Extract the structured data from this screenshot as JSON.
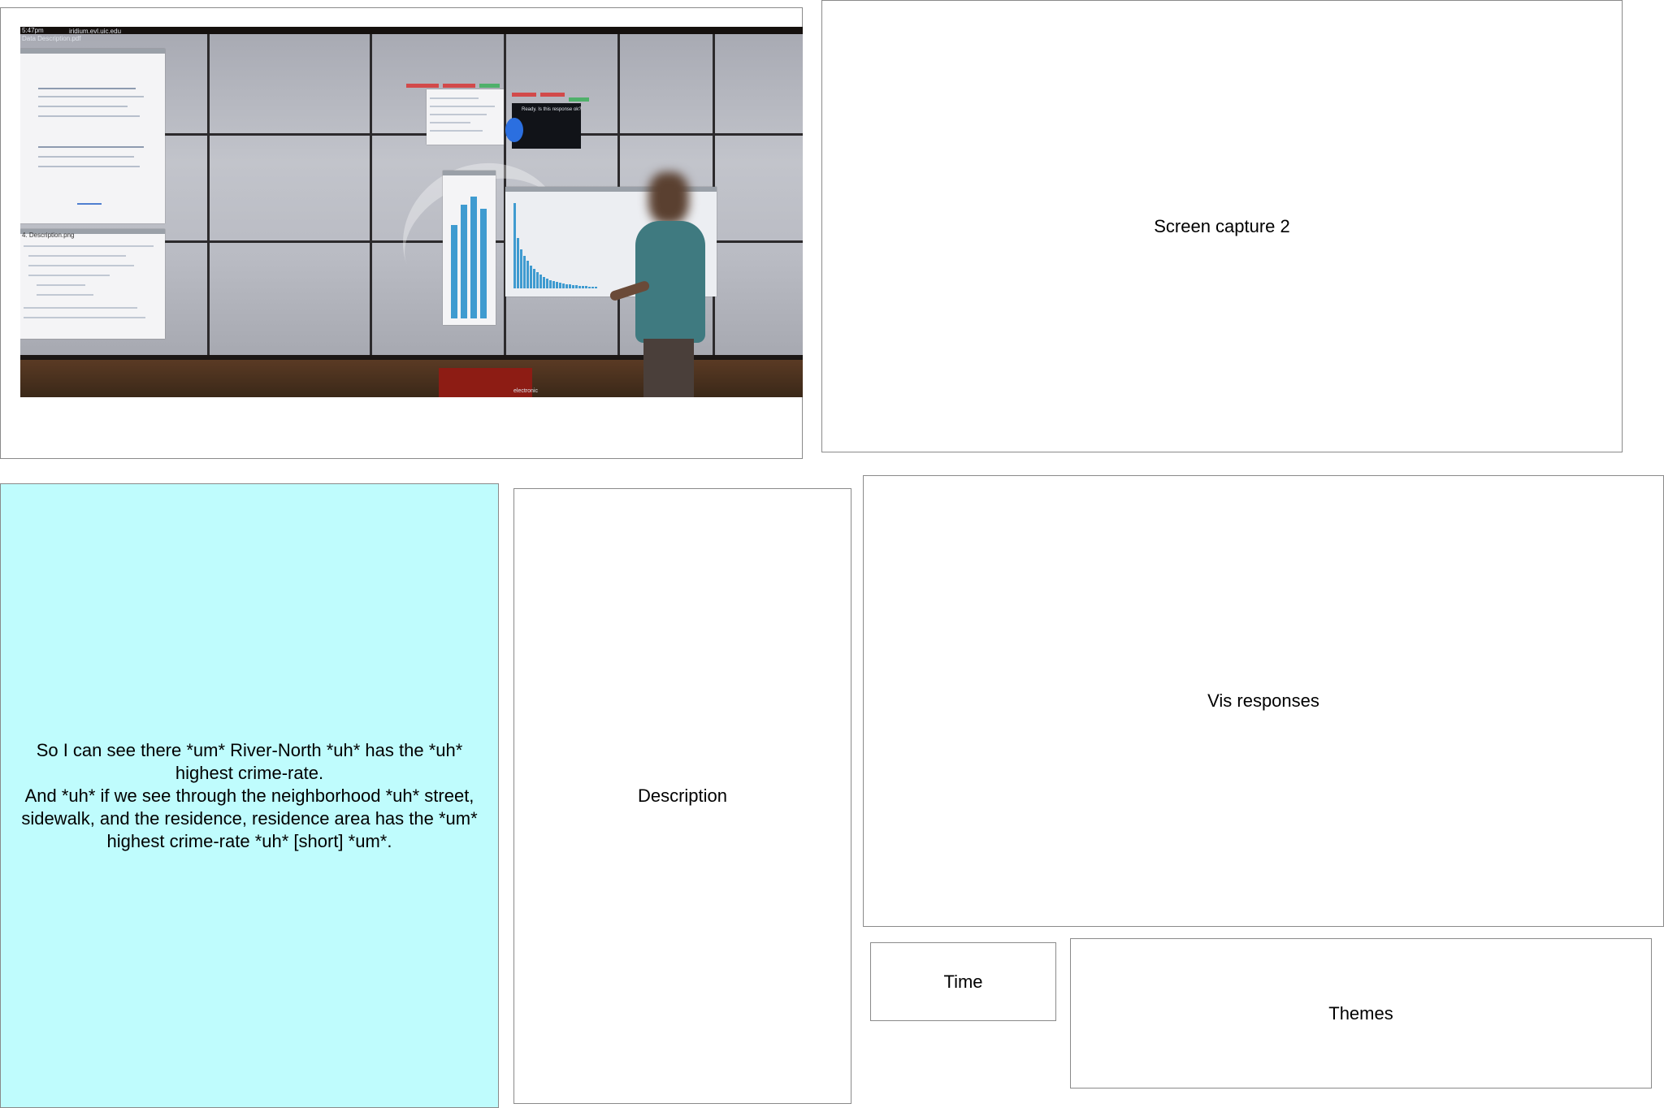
{
  "panels": {
    "screen_capture_1": {
      "wall_caption_host": "iridium.evl.uic.edu",
      "wall_caption_file": "Data Description.pdf",
      "wall_caption_time": "5:47pm",
      "wall_caption_window2": "4. Description.png",
      "dialog_text": "Ready. Is this response ok?",
      "sign_text": "electronic"
    },
    "screen_capture_2": {
      "label": "Screen capture 2"
    },
    "transcript": {
      "lines": [
        "So I can see there *um* River-North *uh* has the *uh*",
        "highest crime-rate.",
        "And *uh* if we see through the neighborhood *uh* street,",
        "sidewalk, and the residence, residence area has the *um*",
        "highest crime-rate *uh* [short] *um*."
      ]
    },
    "description": {
      "label": "Description"
    },
    "vis_responses": {
      "label": "Vis responses"
    },
    "time": {
      "label": "Time"
    },
    "themes": {
      "label": "Themes"
    }
  },
  "colors": {
    "transcript_bg": "#bffcfd",
    "panel_border": "#8a8a8a",
    "bar_color": "#3f9bd0"
  }
}
